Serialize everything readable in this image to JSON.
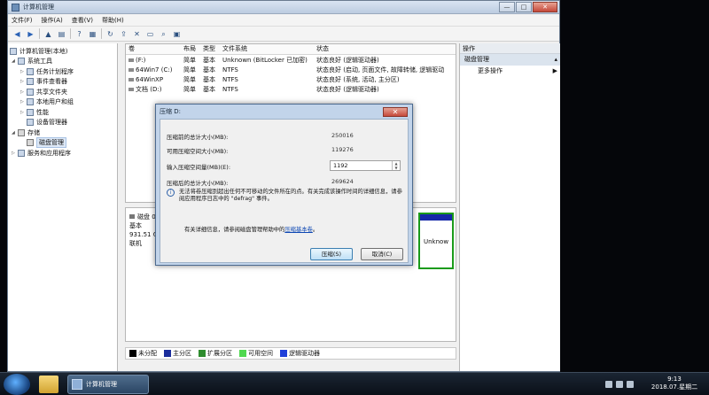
{
  "window": {
    "title": "计算机管理",
    "min_label": "—",
    "max_label": "□",
    "close_label": "✕"
  },
  "menu": [
    "文件(F)",
    "操作(A)",
    "查看(V)",
    "帮助(H)"
  ],
  "tree": {
    "items": [
      {
        "label": "计算机管理(本地)"
      },
      {
        "label": "系统工具"
      },
      {
        "label": "任务计划程序"
      },
      {
        "label": "事件查看器"
      },
      {
        "label": "共享文件夹"
      },
      {
        "label": "本地用户和组"
      },
      {
        "label": "性能"
      },
      {
        "label": "设备管理器"
      },
      {
        "label": "存储"
      },
      {
        "label": "磁盘管理"
      },
      {
        "label": "服务和应用程序"
      }
    ]
  },
  "volume_table": {
    "headers": [
      "卷",
      "布局",
      "类型",
      "文件系统",
      "状态"
    ],
    "rows": [
      [
        "(F:)",
        "简单",
        "基本",
        "Unknown (BitLocker 已加密)",
        "状态良好 (逻辑驱动器)"
      ],
      [
        "64Win7 (C:)",
        "简单",
        "基本",
        "NTFS",
        "状态良好 (启动, 页面文件, 故障转储, 逻辑驱动"
      ],
      [
        "64WinXP",
        "简单",
        "基本",
        "NTFS",
        "状态良好 (系统, 活动, 主分区)"
      ],
      [
        "文档 (D:)",
        "简单",
        "基本",
        "NTFS",
        "状态良好 (逻辑驱动器)"
      ]
    ]
  },
  "disk": {
    "name": "磁盘 0",
    "type": "基本",
    "size": "931.51 GB",
    "status": "联机",
    "right_part_label": "Unknow"
  },
  "legend": [
    {
      "label": "未分配",
      "color": "#000000"
    },
    {
      "label": "主分区",
      "color": "#1a2d9c"
    },
    {
      "label": "扩展分区",
      "color": "#2e8c2e"
    },
    {
      "label": "可用空间",
      "color": "#4fd84f"
    },
    {
      "label": "逻辑驱动器",
      "color": "#1f3fd9"
    }
  ],
  "actions": {
    "header": "操作",
    "section": "磁盘管理",
    "more": "更多操作"
  },
  "dialog": {
    "title": "压缩 D:",
    "close_label": "✕",
    "total_before_label": "压缩前的总计大小(MB):",
    "total_before_value": "250016",
    "available_label": "可用压缩空间大小(MB):",
    "available_value": "119276",
    "input_label": "输入压缩空间量(MB)(E):",
    "input_value": "1192",
    "total_after_label": "压缩后的总计大小(MB):",
    "total_after_value": "269624",
    "info_text": "无法将卷压缩到超出任何不可移动的文件所在的点。有关完成该操作时间的详细信息，请参阅应用程序日志中的 \"defrag\" 事件。",
    "help_prefix": "有关详细信息，请参阅磁盘管理帮助中的",
    "help_link": "压缩基本卷",
    "help_suffix": "。",
    "shrink_button": "压缩(S)",
    "cancel_button": "取消(C)"
  },
  "taskbar": {
    "app_label": "计算机管理",
    "time": "9:13",
    "date": "2018.07.星期二"
  }
}
